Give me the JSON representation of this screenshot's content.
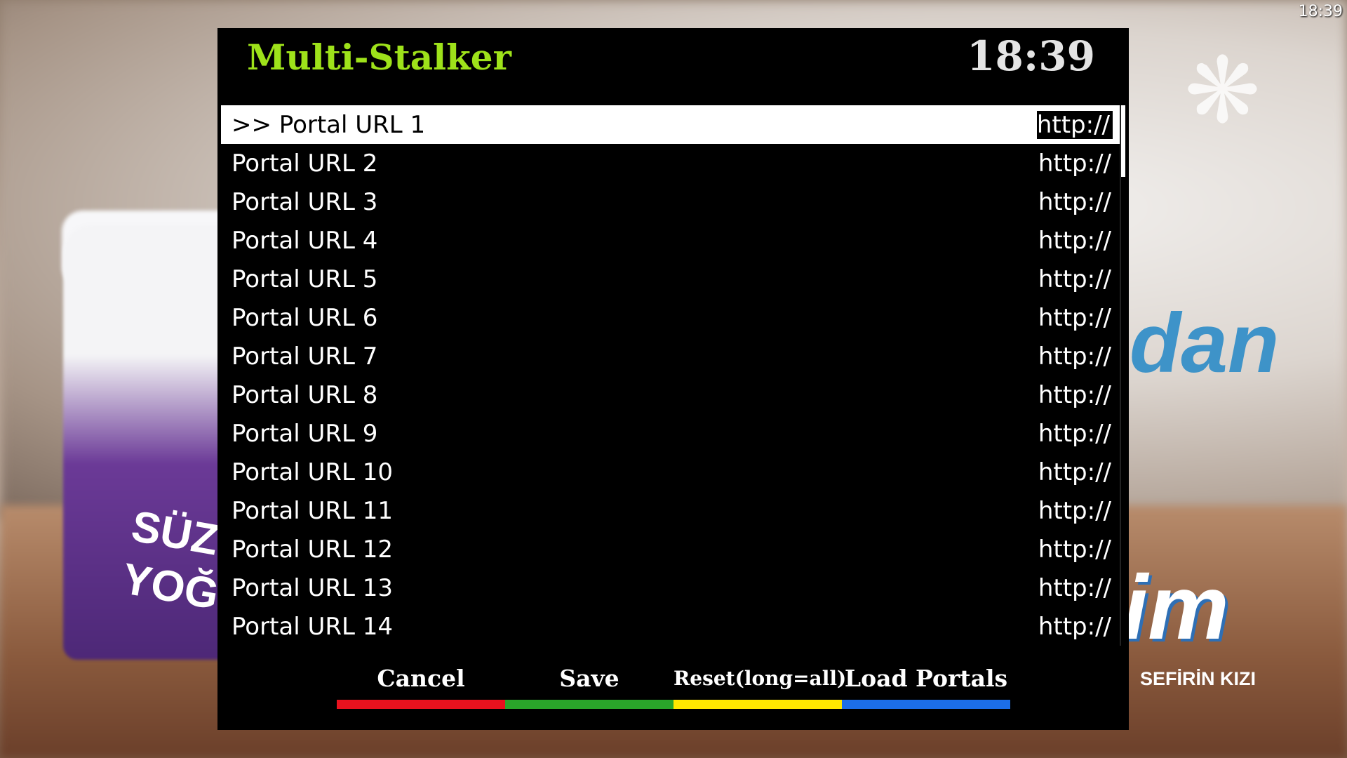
{
  "system": {
    "clock": "18:39"
  },
  "background": {
    "cup_text_line1": "SÜZME",
    "cup_text_line2": "YOĞU",
    "blue_text": "dan",
    "brand": "im",
    "slogan": "SEFİRİN KIZI",
    "logo_glyph": "❋"
  },
  "dialog": {
    "title": "Multi-Stalker",
    "clock": "18:39",
    "items": [
      {
        "label": ">> Portal URL 1",
        "value": "http://",
        "selected": true
      },
      {
        "label": "Portal URL 2",
        "value": "http://"
      },
      {
        "label": "Portal URL 3",
        "value": "http://"
      },
      {
        "label": "Portal URL 4",
        "value": "http://"
      },
      {
        "label": "Portal URL 5",
        "value": "http://"
      },
      {
        "label": "Portal URL 6",
        "value": "http://"
      },
      {
        "label": "Portal URL 7",
        "value": "http://"
      },
      {
        "label": "Portal URL 8",
        "value": "http://"
      },
      {
        "label": "Portal URL 9",
        "value": "http://"
      },
      {
        "label": "Portal URL 10",
        "value": "http://"
      },
      {
        "label": "Portal URL 11",
        "value": "http://"
      },
      {
        "label": "Portal URL 12",
        "value": "http://"
      },
      {
        "label": "Portal URL 13",
        "value": "http://"
      },
      {
        "label": "Portal URL 14",
        "value": "http://"
      }
    ],
    "buttons": [
      {
        "label": "Cancel",
        "color": "#e8121e",
        "key": "red"
      },
      {
        "label": "Save",
        "color": "#2aa52a",
        "key": "green"
      },
      {
        "label": "Reset(long=all)",
        "color": "#ffe800",
        "key": "yellow"
      },
      {
        "label": "Load Portals",
        "color": "#1c6ee8",
        "key": "blue"
      }
    ]
  }
}
